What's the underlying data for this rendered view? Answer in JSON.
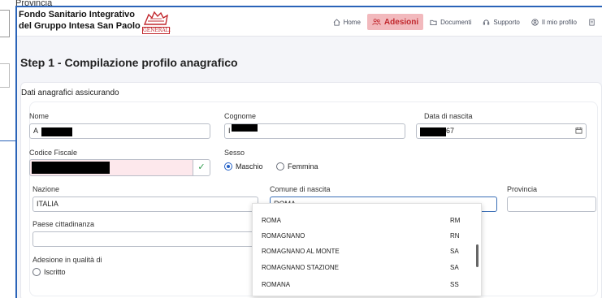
{
  "background": {
    "provincia_label": "Provincia"
  },
  "header": {
    "brand_line1": "Fondo Sanitario Integrativo",
    "brand_line2": "del Gruppo Intesa San Paolo",
    "logo_text": "GENERALI",
    "nav": [
      {
        "label": "Home",
        "icon": "home-icon",
        "active": false
      },
      {
        "label": "Adesioni",
        "icon": "people-icon",
        "active": true
      },
      {
        "label": "Documenti",
        "icon": "folder-icon",
        "active": false
      },
      {
        "label": "Supporto",
        "icon": "support-icon",
        "active": false
      },
      {
        "label": "Il mio profilo",
        "icon": "user-icon",
        "active": false
      }
    ]
  },
  "page": {
    "step_title": "Step 1 - Compilazione profilo anagrafico",
    "section_title": "Dati anagrafici assicurando"
  },
  "form": {
    "nome": {
      "label": "Nome",
      "value": "A"
    },
    "cognome": {
      "label": "Cognome",
      "value": "I"
    },
    "data_nascita": {
      "label": "Data di nascita",
      "value": "67"
    },
    "codice_fiscale": {
      "label": "Codice Fiscale",
      "value": ""
    },
    "sesso": {
      "label": "Sesso",
      "options": [
        "Maschio",
        "Femmina"
      ],
      "selected": "Maschio"
    },
    "nazione": {
      "label": "Nazione",
      "value": "ITALIA"
    },
    "comune": {
      "label": "Comune di nascita",
      "value": "ROMA"
    },
    "provincia": {
      "label": "Provincia",
      "value": ""
    },
    "paese_cittadinanza": {
      "label": "Paese cittadinanza",
      "value": ""
    },
    "adesione": {
      "label": "Adesione in qualità di",
      "options": [
        "Iscritto"
      ]
    }
  },
  "comune_dropdown": [
    {
      "name": "ROMA",
      "prov": "RM"
    },
    {
      "name": "ROMAGNANO",
      "prov": "RN"
    },
    {
      "name": "ROMAGNANO AL MONTE",
      "prov": "SA"
    },
    {
      "name": "ROMAGNANO STAZIONE",
      "prov": "SA"
    },
    {
      "name": "ROMANA",
      "prov": "SS"
    }
  ],
  "colors": {
    "accent": "#c1272d",
    "active_bg": "#f2b9bd",
    "focus": "#3b6fb6",
    "frame_border": "#2a63b8"
  }
}
